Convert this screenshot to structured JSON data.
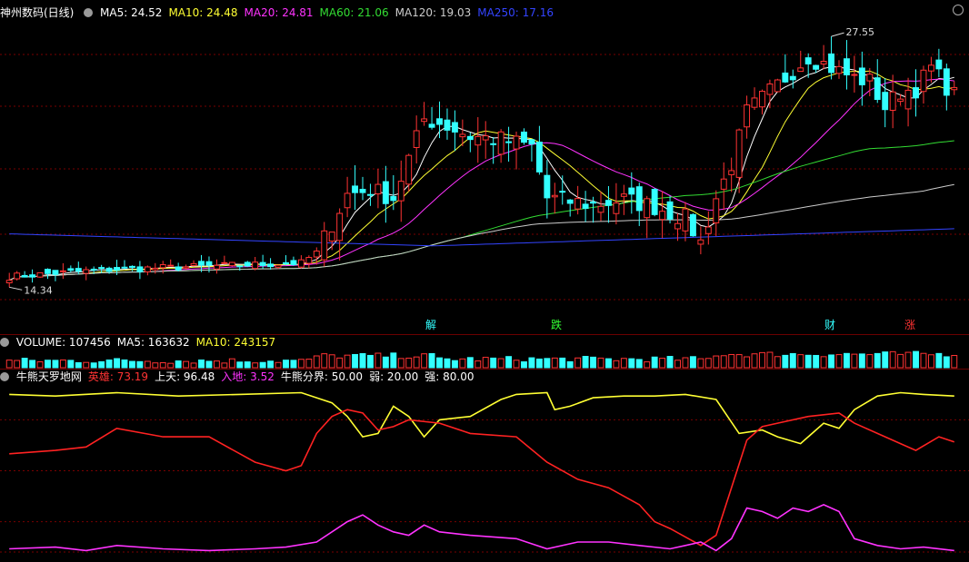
{
  "main": {
    "title": "神州数码(日线)",
    "ma": [
      {
        "label": "MA5: 24.52",
        "color": "#ffffff"
      },
      {
        "label": "MA10: 24.48",
        "color": "#ffff33"
      },
      {
        "label": "MA20: 24.81",
        "color": "#ff33ff"
      },
      {
        "label": "MA60: 21.06",
        "color": "#33dd33"
      },
      {
        "label": "MA120: 19.03",
        "color": "#cccccc"
      },
      {
        "label": "MA250: 17.16",
        "color": "#3344ff"
      }
    ],
    "high_label": "27.55",
    "low_label": "14.34",
    "event_tags": [
      {
        "text": "解",
        "color": "#33ffff"
      },
      {
        "text": "跌",
        "color": "#33ff33"
      },
      {
        "text": "财",
        "color": "#33ffff"
      },
      {
        "text": "涨",
        "color": "#ff3333"
      }
    ]
  },
  "volume": {
    "labels": [
      {
        "text": "VOLUME: 107456",
        "color": "#ffffff"
      },
      {
        "text": "MA5: 163632",
        "color": "#ffffff"
      },
      {
        "text": "MA10: 243157",
        "color": "#ffff33"
      }
    ]
  },
  "indicator": {
    "labels": [
      {
        "text": "牛熊天罗地网",
        "color": "#ffffff"
      },
      {
        "text": "英雄: 73.19",
        "color": "#ff3333"
      },
      {
        "text": "上天: 96.48",
        "color": "#ffffff"
      },
      {
        "text": "入地: 3.52",
        "color": "#ff33ff"
      },
      {
        "text": "牛熊分界: 50.00",
        "color": "#ffffff"
      },
      {
        "text": "弱: 20.00",
        "color": "#ffffff"
      },
      {
        "text": "强: 80.00",
        "color": "#ffffff"
      }
    ]
  },
  "chart_data": [
    {
      "type": "candlestick",
      "ylim": [
        12.0,
        29.5
      ],
      "candle_count": 124,
      "anchor_close": [
        [
          0,
          14.4
        ],
        [
          12,
          14.8
        ],
        [
          25,
          15.0
        ],
        [
          38,
          15.2
        ],
        [
          40,
          15.8
        ],
        [
          44,
          19.2
        ],
        [
          47,
          19.5
        ],
        [
          50,
          19.0
        ],
        [
          54,
          23.6
        ],
        [
          56,
          23.4
        ],
        [
          60,
          22.6
        ],
        [
          64,
          22.4
        ],
        [
          68,
          22.0
        ],
        [
          70,
          19.0
        ],
        [
          76,
          18.6
        ],
        [
          80,
          18.9
        ],
        [
          84,
          18.5
        ],
        [
          88,
          17.8
        ],
        [
          90,
          16.4
        ],
        [
          92,
          19.0
        ],
        [
          94,
          21.0
        ],
        [
          96,
          24.0
        ],
        [
          100,
          25.6
        ],
        [
          104,
          27.3
        ],
        [
          108,
          26.4
        ],
        [
          110,
          26.0
        ],
        [
          112,
          25.8
        ],
        [
          114,
          24.3
        ],
        [
          116,
          25.2
        ],
        [
          118,
          25.4
        ],
        [
          120,
          26.6
        ],
        [
          123,
          25.0
        ]
      ],
      "ma_series": [
        "MA5",
        "MA10",
        "MA20",
        "MA60",
        "MA120",
        "MA250"
      ],
      "ma250_endpoints": [
        16.9,
        16.2,
        17.2
      ]
    },
    {
      "type": "bar",
      "series": [
        {
          "name": "VOLUME",
          "values_note": "relative daily volume"
        }
      ]
    },
    {
      "type": "line",
      "ylim": [
        0,
        100
      ],
      "reference_lines": [
        20,
        50,
        80
      ],
      "series": [
        {
          "name": "上天",
          "color": "#ffff33",
          "points": [
            [
              0,
              95
            ],
            [
              6,
              94
            ],
            [
              14,
              96
            ],
            [
              22,
              94
            ],
            [
              30,
              95
            ],
            [
              38,
              96
            ],
            [
              42,
              90
            ],
            [
              44,
              82
            ],
            [
              46,
              70
            ],
            [
              48,
              72
            ],
            [
              50,
              88
            ],
            [
              52,
              82
            ],
            [
              54,
              70
            ],
            [
              56,
              80
            ],
            [
              60,
              82
            ],
            [
              64,
              92
            ],
            [
              66,
              95
            ],
            [
              70,
              96
            ],
            [
              71,
              86
            ],
            [
              73,
              88
            ],
            [
              76,
              93
            ],
            [
              80,
              94
            ],
            [
              84,
              94
            ],
            [
              88,
              95
            ],
            [
              92,
              92
            ],
            [
              95,
              72
            ],
            [
              98,
              74
            ],
            [
              100,
              70
            ],
            [
              103,
              66
            ],
            [
              106,
              78
            ],
            [
              108,
              75
            ],
            [
              110,
              86
            ],
            [
              113,
              94
            ],
            [
              116,
              96
            ],
            [
              119,
              95
            ],
            [
              123,
              94
            ]
          ]
        },
        {
          "name": "英雄",
          "color": "#ff2222",
          "points": [
            [
              0,
              60
            ],
            [
              6,
              62
            ],
            [
              10,
              64
            ],
            [
              14,
              75
            ],
            [
              20,
              70
            ],
            [
              26,
              70
            ],
            [
              32,
              55
            ],
            [
              36,
              50
            ],
            [
              38,
              53
            ],
            [
              40,
              72
            ],
            [
              42,
              82
            ],
            [
              44,
              86
            ],
            [
              46,
              84
            ],
            [
              48,
              74
            ],
            [
              50,
              76
            ],
            [
              52,
              80
            ],
            [
              56,
              78
            ],
            [
              60,
              72
            ],
            [
              66,
              70
            ],
            [
              70,
              55
            ],
            [
              74,
              45
            ],
            [
              78,
              40
            ],
            [
              82,
              30
            ],
            [
              84,
              20
            ],
            [
              86,
              16
            ],
            [
              88,
              11
            ],
            [
              90,
              6
            ],
            [
              92,
              12
            ],
            [
              94,
              40
            ],
            [
              96,
              68
            ],
            [
              98,
              76
            ],
            [
              100,
              78
            ],
            [
              104,
              82
            ],
            [
              108,
              84
            ],
            [
              110,
              78
            ],
            [
              113,
              72
            ],
            [
              116,
              66
            ],
            [
              118,
              62
            ],
            [
              121,
              70
            ],
            [
              123,
              67
            ]
          ]
        },
        {
          "name": "入地",
          "color": "#ff33ff",
          "points": [
            [
              0,
              4
            ],
            [
              6,
              5
            ],
            [
              10,
              3
            ],
            [
              14,
              6
            ],
            [
              20,
              4
            ],
            [
              26,
              3
            ],
            [
              32,
              4
            ],
            [
              36,
              5
            ],
            [
              40,
              8
            ],
            [
              44,
              20
            ],
            [
              46,
              24
            ],
            [
              48,
              18
            ],
            [
              50,
              14
            ],
            [
              52,
              12
            ],
            [
              54,
              18
            ],
            [
              56,
              14
            ],
            [
              60,
              12
            ],
            [
              66,
              10
            ],
            [
              70,
              4
            ],
            [
              74,
              8
            ],
            [
              78,
              8
            ],
            [
              82,
              6
            ],
            [
              86,
              4
            ],
            [
              88,
              6
            ],
            [
              90,
              8
            ],
            [
              92,
              3
            ],
            [
              94,
              10
            ],
            [
              96,
              28
            ],
            [
              98,
              26
            ],
            [
              100,
              22
            ],
            [
              102,
              28
            ],
            [
              104,
              26
            ],
            [
              106,
              30
            ],
            [
              108,
              26
            ],
            [
              110,
              10
            ],
            [
              113,
              6
            ],
            [
              116,
              4
            ],
            [
              119,
              5
            ],
            [
              123,
              3
            ]
          ]
        }
      ]
    }
  ]
}
